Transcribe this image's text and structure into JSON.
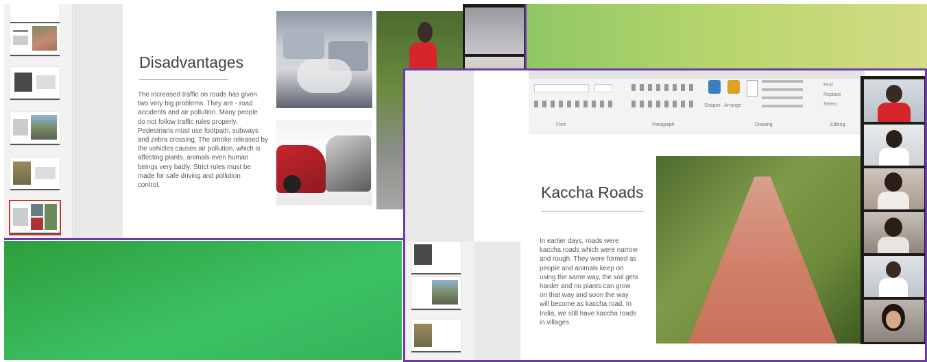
{
  "slide_left": {
    "title": "Disadvantages",
    "body": "The increased traffic on roads has given\ntwo very big problems. They are - road\naccidents and air pollution. Many people\ndo not follow traffic rules properly.\nPedestrians must use footpath, subways\nand zebra crossing. The smoke released by\nthe vehicles causes air pollution, which is\naffecting plants, animals even human\nbeings very badly. Strict rules must be\nmade for safe driving and pollution\ncontrol."
  },
  "slide_right": {
    "title": "Kaccha Roads",
    "body": "In earlier days, roads were\nkaccha roads which were narrow\nand rough. They were formed as\npeople and animals keep on\nusing the same way, the soil gets\nharder and no plants can grow\non that way and soon the way\nwill become as kaccha road. In\nIndia, we still have kaccha roads\nin villages."
  },
  "ribbon": {
    "groups": [
      "Font",
      "Paragraph",
      "Drawing",
      "Editing"
    ],
    "buttons": [
      "Shapes",
      "Arrange",
      "Find",
      "Replace",
      "Select"
    ]
  },
  "colors": {
    "share_border": "#6b3aa8",
    "green_panel": "#3cc265",
    "title_text": "#404040"
  }
}
